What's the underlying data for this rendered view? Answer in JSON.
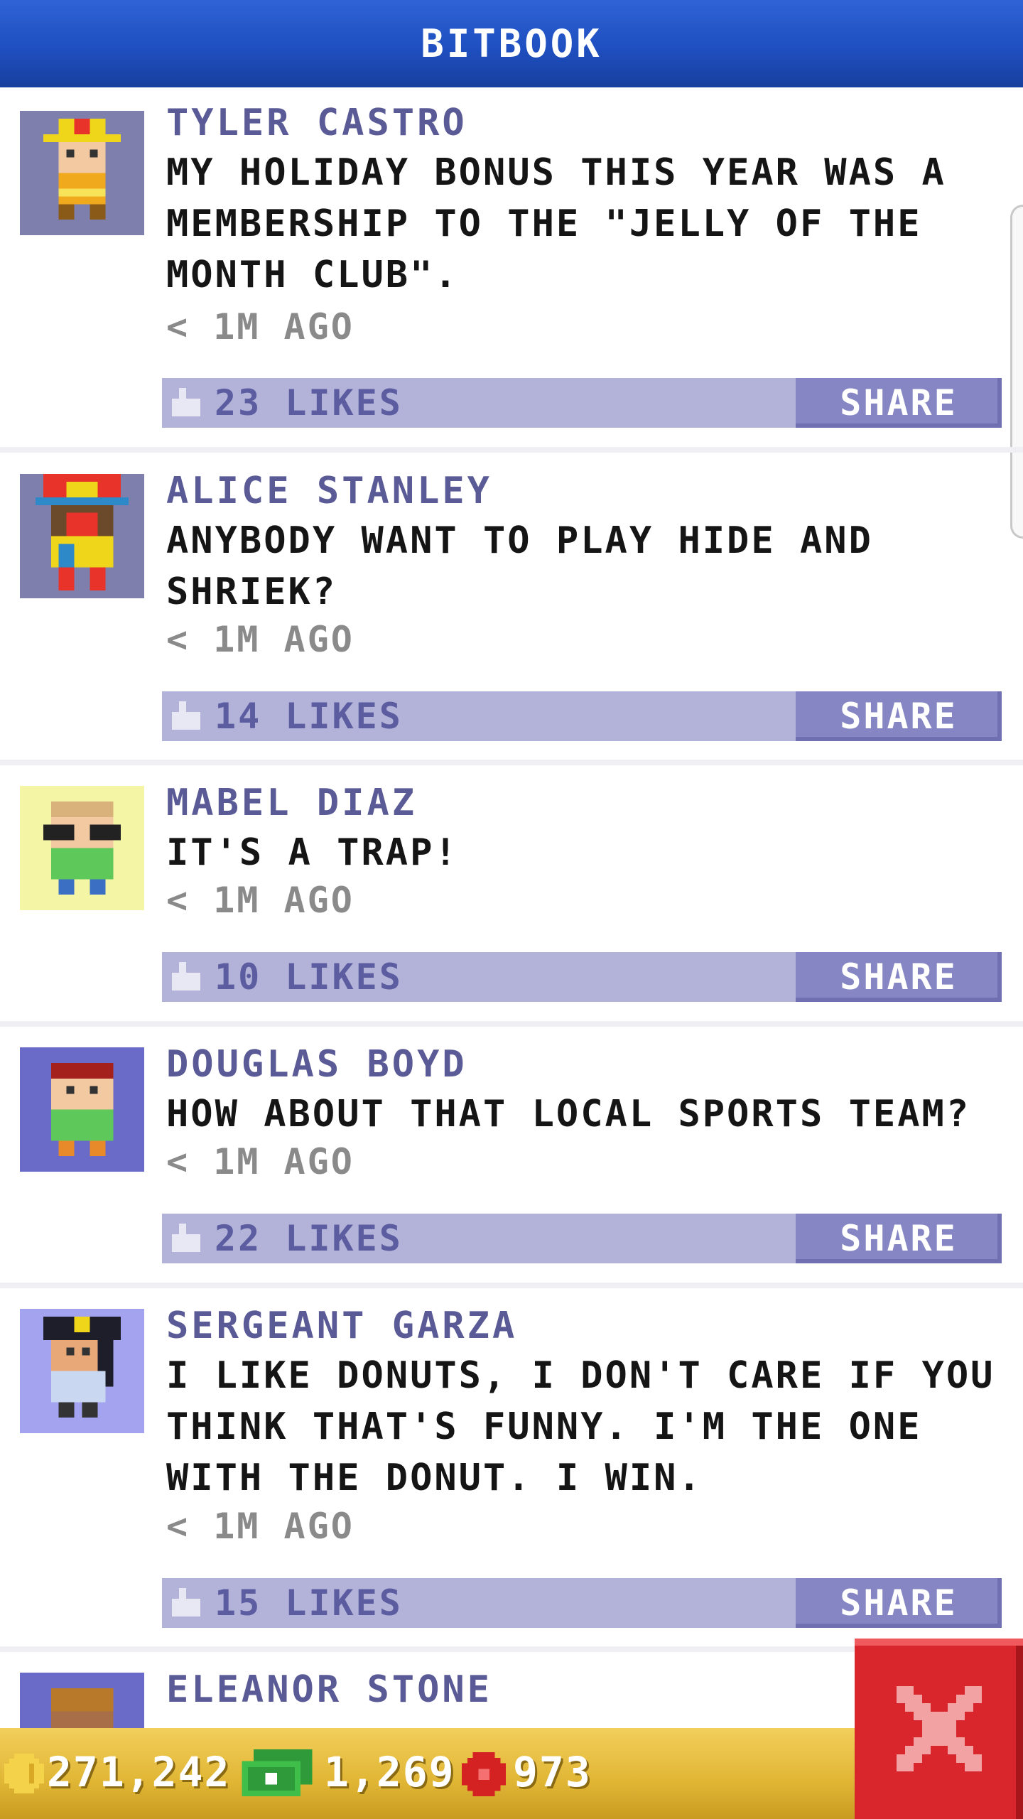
{
  "header": {
    "title": "BITBOOK"
  },
  "posts": [
    {
      "name": "TYLER CASTRO",
      "message": "MY HOLIDAY BONUS THIS YEAR WAS A MEMBERSHIP TO THE \"JELLY OF THE MONTH CLUB\".",
      "time": "< 1M AGO",
      "likes": "23 LIKES",
      "share_label": "SHARE",
      "avatar": "firefighter-avatar"
    },
    {
      "name": "ALICE STANLEY",
      "message": "ANYBODY WANT TO PLAY HIDE AND SHRIEK?",
      "time": "< 1M AGO",
      "likes": "14 LIKES",
      "share_label": "SHARE",
      "avatar": "clown-avatar"
    },
    {
      "name": "MABEL DIAZ",
      "message": "IT'S A TRAP!",
      "time": "< 1M AGO",
      "likes": "10 LIKES",
      "share_label": "SHARE",
      "avatar": "glasses-avatar"
    },
    {
      "name": "DOUGLAS BOYD",
      "message": "HOW ABOUT THAT LOCAL SPORTS TEAM?",
      "time": "< 1M AGO",
      "likes": "22 LIKES",
      "share_label": "SHARE",
      "avatar": "red-hair-avatar"
    },
    {
      "name": "SERGEANT GARZA",
      "message": "I LIKE DONUTS, I DON'T CARE IF YOU THINK THAT'S FUNNY. I'M THE ONE WITH THE DONUT. I WIN.",
      "time": "< 1M AGO",
      "likes": "15 LIKES",
      "share_label": "SHARE",
      "avatar": "police-avatar"
    },
    {
      "name": "ELEANOR STONE",
      "avatar": "eleanor-avatar"
    }
  ],
  "footer": {
    "coins": "271,242",
    "bux": "1,269",
    "gems": "973",
    "coin_icon": "coin-icon",
    "bux_icon": "bux-icon",
    "gem_icon": "gem-icon"
  },
  "close_button": {
    "icon": "close-icon"
  },
  "colors": {
    "header_blue": "#1f4fc0",
    "like_bar": "#b3b3d9",
    "share_button": "#8686c4",
    "name_text": "#5a5a96",
    "footer_gold": "#e0b534",
    "close_red": "#d8262c"
  }
}
